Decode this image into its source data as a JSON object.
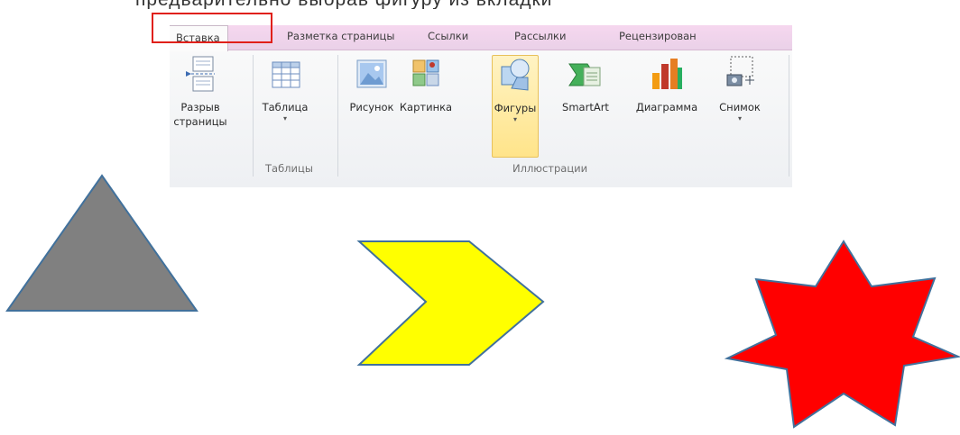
{
  "caption": {
    "text": "предварительно выбрав фигуру из вкладки"
  },
  "ribbon": {
    "tabs": [
      {
        "label": "Вставка",
        "active": true
      },
      {
        "label": "Разметка страницы"
      },
      {
        "label": "Ссылки"
      },
      {
        "label": "Рассылки"
      },
      {
        "label": "Рецензирован"
      }
    ],
    "buttons": {
      "page_break": {
        "label_line1": "Разрыв",
        "label_line2": "страницы",
        "icon": "page-break-icon"
      },
      "table": {
        "label": "Таблица",
        "dropdown": "▾",
        "icon": "table-icon"
      },
      "picture": {
        "label": "Рисунок",
        "icon": "picture-icon"
      },
      "clipart": {
        "label": "Картинка",
        "icon": "clipart-icon"
      },
      "shapes": {
        "label": "Фигуры",
        "dropdown": "▾",
        "icon": "shapes-icon"
      },
      "smartart": {
        "label": "SmartArt",
        "icon": "smartart-icon"
      },
      "chart": {
        "label": "Диаграмма",
        "icon": "chart-icon"
      },
      "screenshot": {
        "label": "Снимок",
        "dropdown": "▾",
        "icon": "screenshot-icon"
      }
    },
    "groups": {
      "tables": "Таблицы",
      "illustrations": "Иллюстрации"
    }
  },
  "colors": {
    "highlight_box": "#e0201a",
    "triangle": "#808080",
    "chevron": "#ffff00",
    "star": "#ff0000",
    "shape_outline": "#41719c"
  }
}
